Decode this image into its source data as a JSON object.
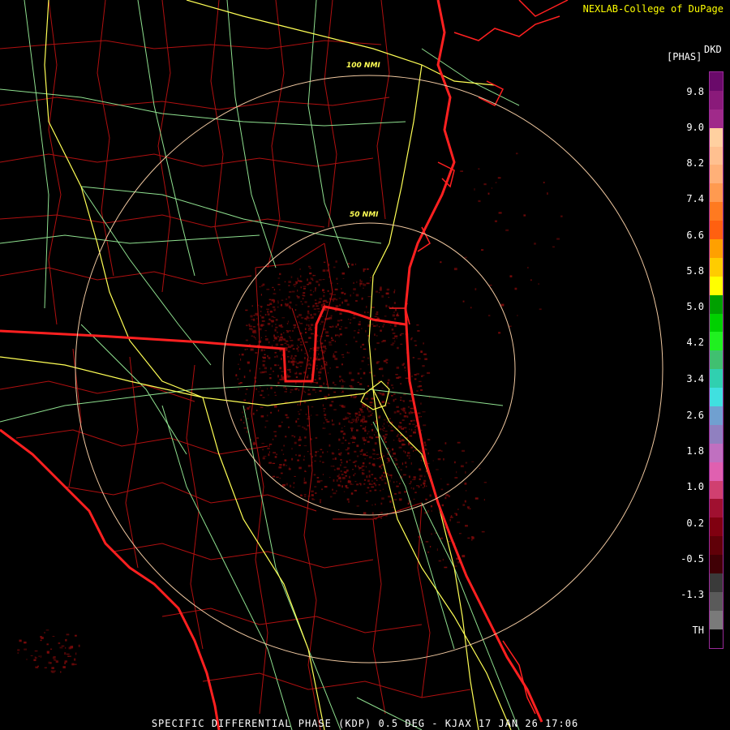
{
  "credit": "NEXLAB-College of DuPage",
  "product_code": "DKD",
  "units": "[PHAS]",
  "footer": "SPECIFIC DIFFERENTIAL PHASE (KDP) 0.5 DEG - KJAX 17 JAN 26 17:06",
  "rings": [
    {
      "label": "50 NMI"
    },
    {
      "label": "100 NMI"
    }
  ],
  "scale_labels": [
    "9.8",
    "9.0",
    "8.2",
    "7.4",
    "6.6",
    "5.8",
    "5.0",
    "4.2",
    "3.4",
    "2.6",
    "1.8",
    "1.0",
    "0.2",
    "-0.5",
    "-1.3",
    "TH"
  ],
  "colors": {
    "state_border": "#ff2020",
    "county_border": "#b01010",
    "highway": "#ffff55",
    "road": "#8fe08f",
    "range_ring": "#f0c8a0",
    "echo": "#7a0a0a"
  },
  "colorbar": [
    "#6a0a6a",
    "#8a1a7a",
    "#a02a8a",
    "#ffd0a0",
    "#ffc090",
    "#ffb078",
    "#ff9a50",
    "#ff7a20",
    "#ff6010",
    "#ffa000",
    "#ffcc00",
    "#ffff00",
    "#00a000",
    "#00d000",
    "#20f020",
    "#40c070",
    "#30d0b0",
    "#40e0e0",
    "#70a0d0",
    "#9080c0",
    "#c070c0",
    "#e060b0",
    "#d04070",
    "#a01030",
    "#800010",
    "#600008",
    "#400005",
    "#3a3a3a",
    "#5a5a5a",
    "#7a7a7a",
    "#000000"
  ]
}
